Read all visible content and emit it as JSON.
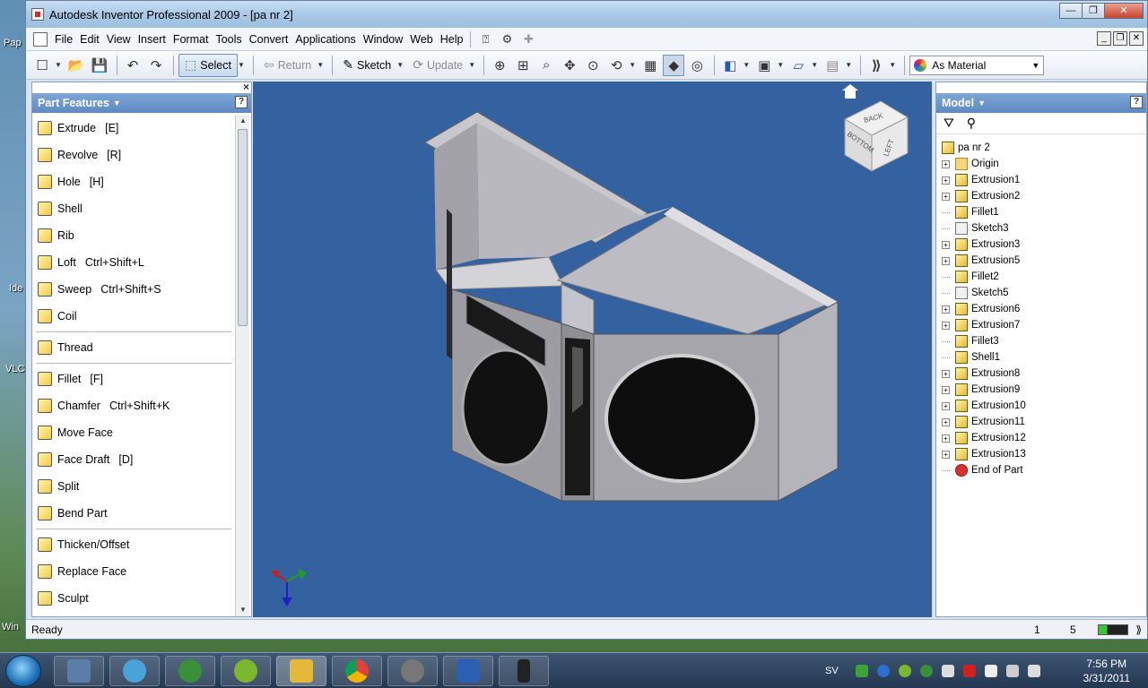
{
  "window": {
    "title": "Autodesk Inventor Professional 2009 - [pa nr 2]",
    "min": "—",
    "max": "❐",
    "close": "✕"
  },
  "menu": [
    "File",
    "Edit",
    "View",
    "Insert",
    "Format",
    "Tools",
    "Convert",
    "Applications",
    "Window",
    "Web",
    "Help"
  ],
  "toolbar": {
    "select_label": "Select",
    "return_label": "Return",
    "sketch_label": "Sketch",
    "update_label": "Update",
    "material_value": "As Material"
  },
  "left_panel": {
    "title": "Part Features",
    "help": "?",
    "close": "×",
    "features": [
      {
        "label": "Extrude",
        "shortcut": "[E]"
      },
      {
        "label": "Revolve",
        "shortcut": "[R]"
      },
      {
        "label": "Hole",
        "shortcut": "[H]"
      },
      {
        "label": "Shell",
        "shortcut": ""
      },
      {
        "label": "Rib",
        "shortcut": ""
      },
      {
        "label": "Loft",
        "shortcut": "Ctrl+Shift+L"
      },
      {
        "label": "Sweep",
        "shortcut": "Ctrl+Shift+S"
      },
      {
        "label": "Coil",
        "shortcut": ""
      },
      {
        "label": "Thread",
        "shortcut": ""
      },
      {
        "label": "Fillet",
        "shortcut": "[F]"
      },
      {
        "label": "Chamfer",
        "shortcut": "Ctrl+Shift+K"
      },
      {
        "label": "Move Face",
        "shortcut": ""
      },
      {
        "label": "Face Draft",
        "shortcut": "[D]"
      },
      {
        "label": "Split",
        "shortcut": ""
      },
      {
        "label": "Bend Part",
        "shortcut": ""
      },
      {
        "label": "Thicken/Offset",
        "shortcut": ""
      },
      {
        "label": "Replace Face",
        "shortcut": ""
      },
      {
        "label": "Sculpt",
        "shortcut": ""
      }
    ]
  },
  "viewcube": {
    "face_top": "BACK",
    "face_left": "BOTTOM",
    "face_right": "LEFT"
  },
  "right_panel": {
    "title": "Model",
    "help": "?",
    "root": "pa nr 2",
    "nodes": [
      {
        "label": "Origin",
        "type": "folder",
        "expand": true
      },
      {
        "label": "Extrusion1",
        "type": "feature",
        "expand": true
      },
      {
        "label": "Extrusion2",
        "type": "feature",
        "expand": true
      },
      {
        "label": "Fillet1",
        "type": "feature",
        "expand": false
      },
      {
        "label": "Sketch3",
        "type": "sketch",
        "expand": false
      },
      {
        "label": "Extrusion3",
        "type": "feature",
        "expand": true
      },
      {
        "label": "Extrusion5",
        "type": "feature",
        "expand": true
      },
      {
        "label": "Fillet2",
        "type": "feature",
        "expand": false
      },
      {
        "label": "Sketch5",
        "type": "sketch",
        "expand": false
      },
      {
        "label": "Extrusion6",
        "type": "feature",
        "expand": true
      },
      {
        "label": "Extrusion7",
        "type": "feature",
        "expand": true
      },
      {
        "label": "Fillet3",
        "type": "feature",
        "expand": false
      },
      {
        "label": "Shell1",
        "type": "feature",
        "expand": false
      },
      {
        "label": "Extrusion8",
        "type": "feature",
        "expand": true
      },
      {
        "label": "Extrusion9",
        "type": "feature",
        "expand": true
      },
      {
        "label": "Extrusion10",
        "type": "feature",
        "expand": true
      },
      {
        "label": "Extrusion11",
        "type": "feature",
        "expand": true
      },
      {
        "label": "Extrusion12",
        "type": "feature",
        "expand": true
      },
      {
        "label": "Extrusion13",
        "type": "feature",
        "expand": true
      },
      {
        "label": "End of Part",
        "type": "end",
        "expand": false
      }
    ]
  },
  "status": {
    "text": "Ready",
    "n1": "1",
    "n2": "5"
  },
  "desktop": {
    "labels": [
      "Pap",
      "Ide",
      "VLC",
      "Win"
    ]
  },
  "taskbar": {
    "lang": "SV",
    "time": "7:56 PM",
    "date": "3/31/2011"
  },
  "colors": {
    "viewport_bg": "#3462a0",
    "panel_head": "#6a93c9",
    "title_bar": "#a9c8e6"
  }
}
